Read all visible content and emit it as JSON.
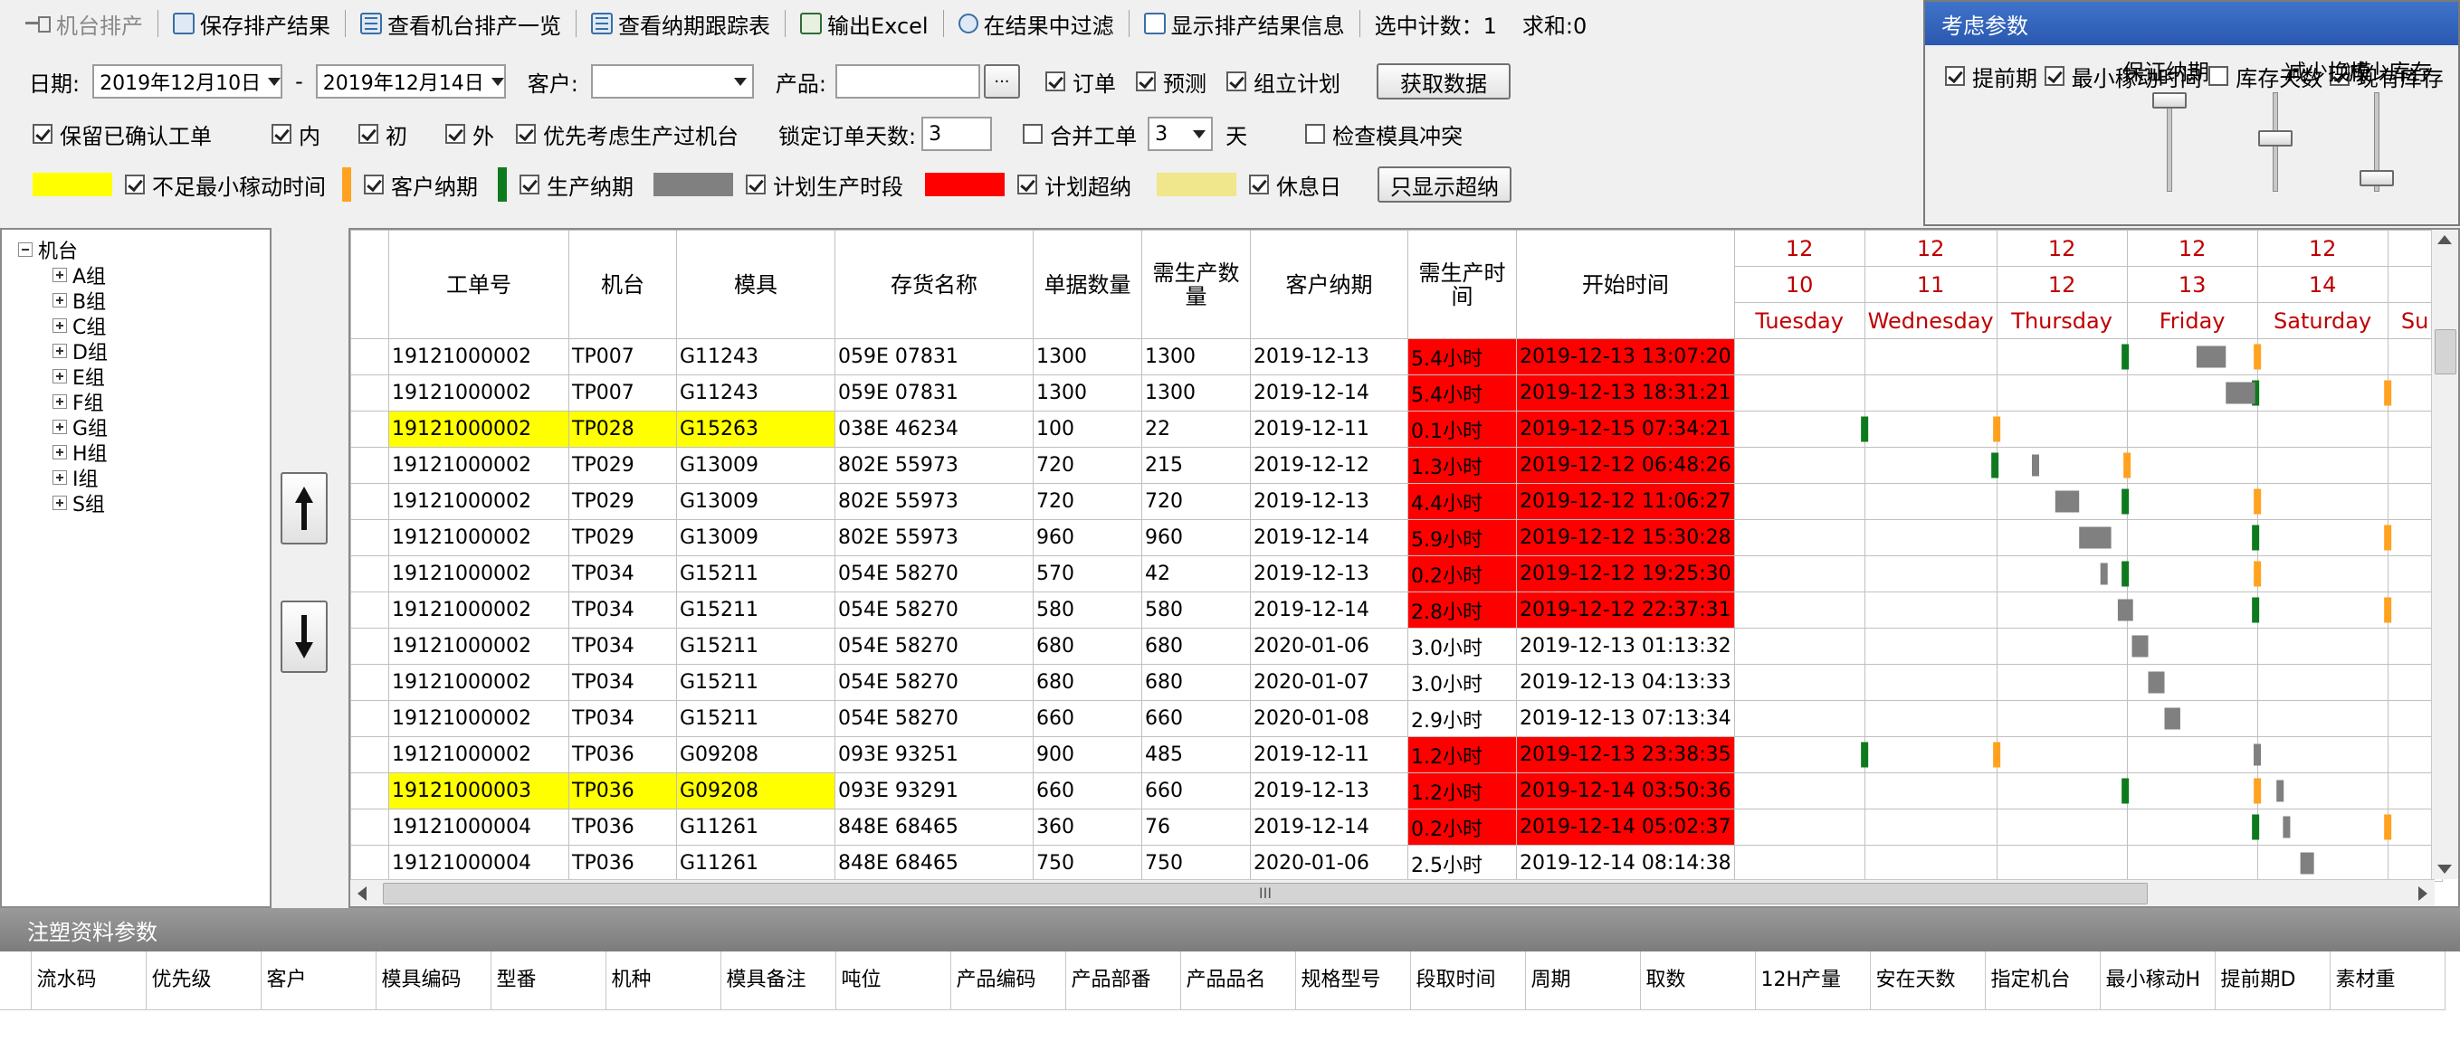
{
  "toolbar": {
    "machine_schedule": "机台排产",
    "save": "保存排产结果",
    "view_machine": "查看机台排产一览",
    "view_deadline": "查看纳期跟踪表",
    "export_excel": "输出Excel",
    "filter": "在结果中过滤",
    "show_info": "显示排产结果信息",
    "selected_count": "选中计数：1",
    "sum": "求和:0"
  },
  "filters": {
    "date_label": "日期:",
    "date_from": "2019年12月10日",
    "date_sep": "-",
    "date_to": "2019年12月14日",
    "customer_label": "客户:",
    "customer_value": "",
    "product_label": "产品:",
    "product_value": "",
    "ellipsis": "···",
    "order": "订单",
    "forecast": "预测",
    "assembly_plan": "组立计划",
    "fetch": "获取数据",
    "keep_confirmed": "保留已确认工单",
    "inner": "内",
    "initial": "初",
    "outer": "外",
    "prefer_machine": "优先考虑生产过机台",
    "lock_days_label": "锁定订单天数:",
    "lock_days_value": "3",
    "merge_order": "合并工单",
    "merge_value": "3",
    "day_unit": "天",
    "check_mold": "检查模具冲突"
  },
  "legend": {
    "min_move": "不足最小稼动时间",
    "customer_deadline": "客户纳期",
    "production_deadline": "生产纳期",
    "plan_period": "计划生产时段",
    "plan_overdue": "计划超纳",
    "holiday": "休息日",
    "only_overdue": "只显示超纳",
    "colors": {
      "min_move": "#ffff00",
      "customer_deadline": "#ffa21f",
      "production_deadline": "#0e7a1e",
      "plan_period": "#808080",
      "plan_overdue": "#ff0000",
      "holiday": "#f0e68c"
    }
  },
  "params": {
    "title": "考虑参数",
    "ahead": "提前期",
    "min_move": "最小稼动时间",
    "stock_days": "库存天数",
    "current_stock": "现有库存",
    "guarantee": "保证纳期",
    "reduce_change": "减少换模",
    "reduce_stock": "减少库存"
  },
  "tree": {
    "root": "机台",
    "groups": [
      "A组",
      "B组",
      "C组",
      "D组",
      "E组",
      "F组",
      "G组",
      "H组",
      "I组",
      "S组"
    ]
  },
  "grid": {
    "columns": [
      "工单号",
      "机台",
      "模具",
      "存货名称",
      "单据数量",
      "需生产数量",
      "客户纳期",
      "需生产时间",
      "开始时间"
    ],
    "days": [
      {
        "month": "12",
        "day": "10",
        "weekday": "Tuesday"
      },
      {
        "month": "12",
        "day": "11",
        "weekday": "Wednesday"
      },
      {
        "month": "12",
        "day": "12",
        "weekday": "Thursday"
      },
      {
        "month": "12",
        "day": "13",
        "weekday": "Friday"
      },
      {
        "month": "12",
        "day": "14",
        "weekday": "Saturday"
      },
      {
        "month": "",
        "day": "",
        "weekday": "Su"
      }
    ],
    "rows": [
      {
        "order": "19121000002",
        "machine": "TP007",
        "mold": "G11243",
        "item": "059E 07831",
        "qty": "1300",
        "need": "1300",
        "deadline": "2019-12-13",
        "time": "5.4小时",
        "start": "2019-12-13 13:07:20",
        "red": true,
        "yellow": false
      },
      {
        "order": "19121000002",
        "machine": "TP007",
        "mold": "G11243",
        "item": "059E 07831",
        "qty": "1300",
        "need": "1300",
        "deadline": "2019-12-14",
        "time": "5.4小时",
        "start": "2019-12-13 18:31:21",
        "red": true,
        "yellow": false
      },
      {
        "order": "19121000002",
        "machine": "TP028",
        "mold": "G15263",
        "item": "038E 46234",
        "qty": "100",
        "need": "22",
        "deadline": "2019-12-11",
        "time": "0.1小时",
        "start": "2019-12-15 07:34:21",
        "red": true,
        "yellow": true
      },
      {
        "order": "19121000002",
        "machine": "TP029",
        "mold": "G13009",
        "item": "802E 55973",
        "qty": "720",
        "need": "215",
        "deadline": "2019-12-12",
        "time": "1.3小时",
        "start": "2019-12-12 06:48:26",
        "red": true,
        "yellow": false
      },
      {
        "order": "19121000002",
        "machine": "TP029",
        "mold": "G13009",
        "item": "802E 55973",
        "qty": "720",
        "need": "720",
        "deadline": "2019-12-13",
        "time": "4.4小时",
        "start": "2019-12-12 11:06:27",
        "red": true,
        "yellow": false
      },
      {
        "order": "19121000002",
        "machine": "TP029",
        "mold": "G13009",
        "item": "802E 55973",
        "qty": "960",
        "need": "960",
        "deadline": "2019-12-14",
        "time": "5.9小时",
        "start": "2019-12-12 15:30:28",
        "red": true,
        "yellow": false
      },
      {
        "order": "19121000002",
        "machine": "TP034",
        "mold": "G15211",
        "item": "054E 58270",
        "qty": "570",
        "need": "42",
        "deadline": "2019-12-13",
        "time": "0.2小时",
        "start": "2019-12-12 19:25:30",
        "red": true,
        "yellow": false
      },
      {
        "order": "19121000002",
        "machine": "TP034",
        "mold": "G15211",
        "item": "054E 58270",
        "qty": "580",
        "need": "580",
        "deadline": "2019-12-14",
        "time": "2.8小时",
        "start": "2019-12-12 22:37:31",
        "red": true,
        "yellow": false
      },
      {
        "order": "19121000002",
        "machine": "TP034",
        "mold": "G15211",
        "item": "054E 58270",
        "qty": "680",
        "need": "680",
        "deadline": "2020-01-06",
        "time": "3.0小时",
        "start": "2019-12-13 01:13:32",
        "red": false,
        "yellow": false
      },
      {
        "order": "19121000002",
        "machine": "TP034",
        "mold": "G15211",
        "item": "054E 58270",
        "qty": "680",
        "need": "680",
        "deadline": "2020-01-07",
        "time": "3.0小时",
        "start": "2019-12-13 04:13:33",
        "red": false,
        "yellow": false
      },
      {
        "order": "19121000002",
        "machine": "TP034",
        "mold": "G15211",
        "item": "054E 58270",
        "qty": "660",
        "need": "660",
        "deadline": "2020-01-08",
        "time": "2.9小时",
        "start": "2019-12-13 07:13:34",
        "red": false,
        "yellow": false
      },
      {
        "order": "19121000002",
        "machine": "TP036",
        "mold": "G09208",
        "item": "093E 93251",
        "qty": "900",
        "need": "485",
        "deadline": "2019-12-11",
        "time": "1.2小时",
        "start": "2019-12-13 23:38:35",
        "red": true,
        "yellow": false
      },
      {
        "order": "19121000003",
        "machine": "TP036",
        "mold": "G09208",
        "item": "093E 93291",
        "qty": "660",
        "need": "660",
        "deadline": "2019-12-13",
        "time": "1.2小时",
        "start": "2019-12-14 03:50:36",
        "red": true,
        "yellow": true
      },
      {
        "order": "19121000004",
        "machine": "TP036",
        "mold": "G11261",
        "item": "848E 68465",
        "qty": "360",
        "need": "76",
        "deadline": "2019-12-14",
        "time": "0.2小时",
        "start": "2019-12-14 05:02:37",
        "red": true,
        "yellow": false
      },
      {
        "order": "19121000004",
        "machine": "TP036",
        "mold": "G11261",
        "item": "848E 68465",
        "qty": "750",
        "need": "750",
        "deadline": "2020-01-06",
        "time": "2.5小时",
        "start": "2019-12-14 08:14:38",
        "red": false,
        "yellow": false
      }
    ],
    "scroll_grip": "III"
  },
  "bottom": {
    "title": "注塑资料参数",
    "columns": [
      "流水码",
      "优先级",
      "客户",
      "模具编码",
      "型番",
      "机种",
      "模具备注",
      "吨位",
      "产品编码",
      "产品部番",
      "产品品名",
      "规格型号",
      "段取时间",
      "周期",
      "取数",
      "12H产量",
      "安在天数",
      "指定机台",
      "最小稼动H",
      "提前期D",
      "素材重"
    ]
  }
}
